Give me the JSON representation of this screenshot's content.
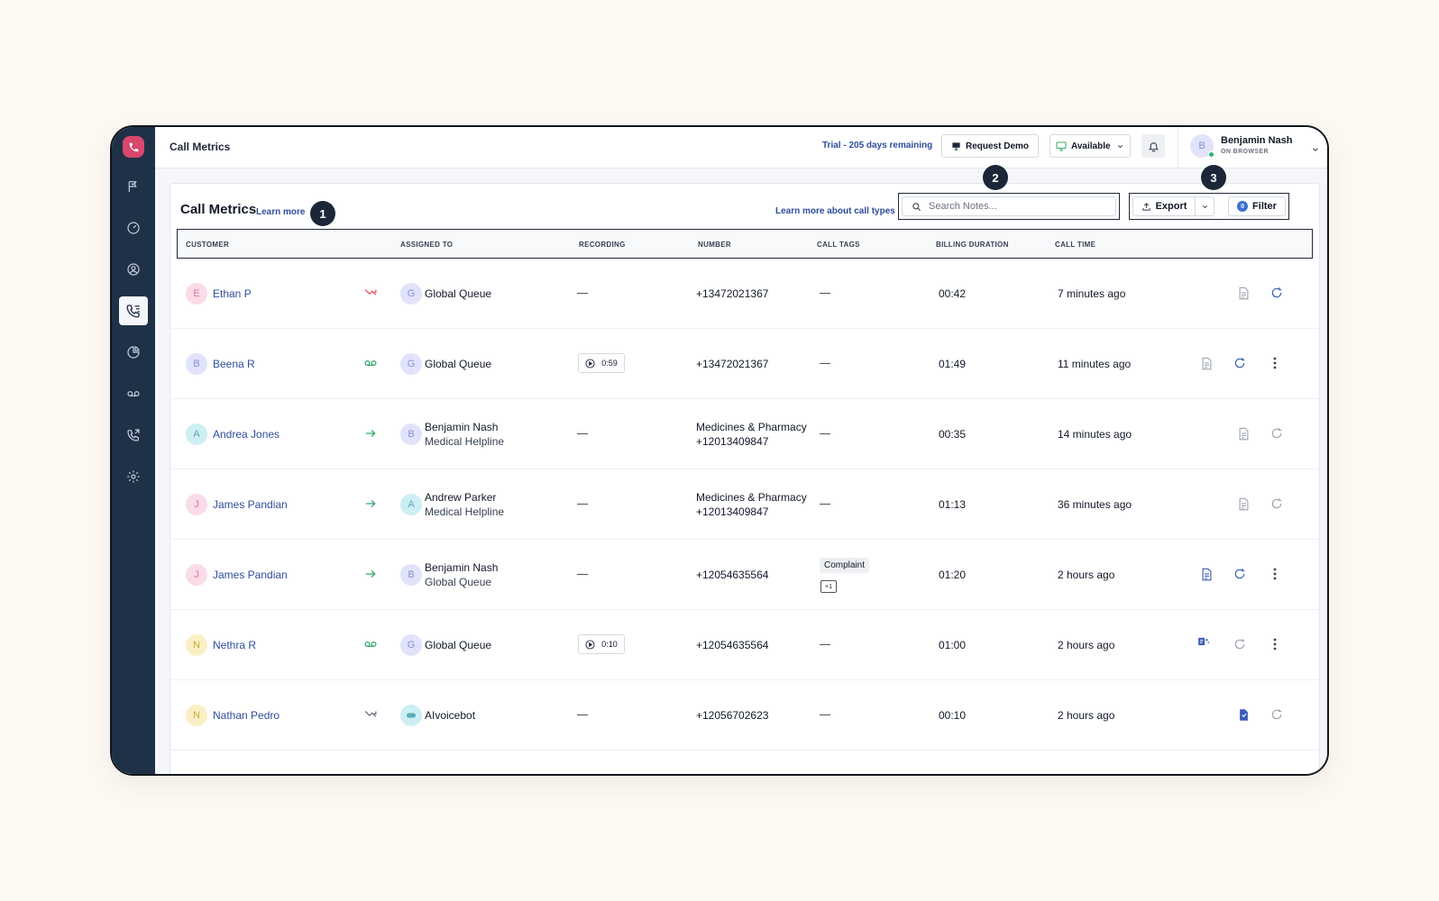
{
  "topbar": {
    "title": "Call Metrics",
    "trial_text": "Trial - 205 days remaining",
    "request_demo_label": "Request Demo",
    "status_label": "Available",
    "user_initial": "B",
    "user_name": "Benjamin Nash",
    "user_sub": "ON BROWSER"
  },
  "page": {
    "title": "Call Metrics",
    "learn_more": "Learn more",
    "learn_more_types": "Learn more about call types",
    "search_placeholder": "Search Notes...",
    "export_label": "Export",
    "filter_label": "Filter",
    "filter_count": "0"
  },
  "callouts": [
    "1",
    "2",
    "3"
  ],
  "table": {
    "headers": [
      "CUSTOMER",
      "ASSIGNED TO",
      "RECORDING",
      "NUMBER",
      "CALL TAGS",
      "BILLING DURATION",
      "CALL TIME"
    ],
    "rows": [
      {
        "cust_initial": "E",
        "customer": "Ethan P",
        "assign_initial": "G",
        "assigned": "Global Queue",
        "recording": "",
        "number": "+13472021367",
        "duration": "00:42",
        "time": "7 minutes ago"
      },
      {
        "cust_initial": "B",
        "customer": "Beena R",
        "assign_initial": "G",
        "assigned": "Global Queue",
        "recording": "0:59",
        "number": "+13472021367",
        "duration": "01:49",
        "time": "11 minutes ago"
      },
      {
        "cust_initial": "A",
        "customer": "Andrea Jones",
        "assign_initial": "B",
        "assigned": "Benjamin Nash",
        "assigned_sub": "Medical Helpline",
        "number_line1": "Medicines & Pharmacy",
        "number": "+12013409847",
        "duration": "00:35",
        "time": "14 minutes ago"
      },
      {
        "cust_initial": "J",
        "customer": "James Pandian",
        "assign_initial": "A",
        "assigned": "Andrew Parker",
        "assigned_sub": "Medical Helpline",
        "number_line1": "Medicines & Pharmacy",
        "number": "+12013409847",
        "duration": "01:13",
        "time": "36 minutes ago"
      },
      {
        "cust_initial": "J",
        "customer": "James Pandian",
        "assign_initial": "B",
        "assigned": "Benjamin Nash",
        "assigned_sub": "Global Queue",
        "number": "+12054635564",
        "tag": "Complaint",
        "tag_more": "+1",
        "duration": "01:20",
        "time": "2 hours ago"
      },
      {
        "cust_initial": "N",
        "customer": "Nethra R",
        "assign_initial": "G",
        "assigned": "Global Queue",
        "recording": "0:10",
        "number": "+12054635564",
        "duration": "01:00",
        "time": "2 hours ago"
      },
      {
        "cust_initial": "N",
        "customer": "Nathan Pedro",
        "assigned": "AIvoicebot",
        "number": "+12056702623",
        "duration": "00:10",
        "time": "2 hours ago"
      }
    ]
  },
  "colors": {
    "sidebar": "#1f3147",
    "accent_link": "#2f4d9c",
    "brand": "#d8476c",
    "missed": "#e0566b",
    "success": "#33a86a"
  },
  "icons": {
    "sidebar": [
      "flag-icon",
      "gauge-icon",
      "user-circle-icon",
      "call-log-icon",
      "pie-chart-icon",
      "voicemail-icon",
      "phone-outgoing-icon",
      "gear-icon"
    ]
  }
}
